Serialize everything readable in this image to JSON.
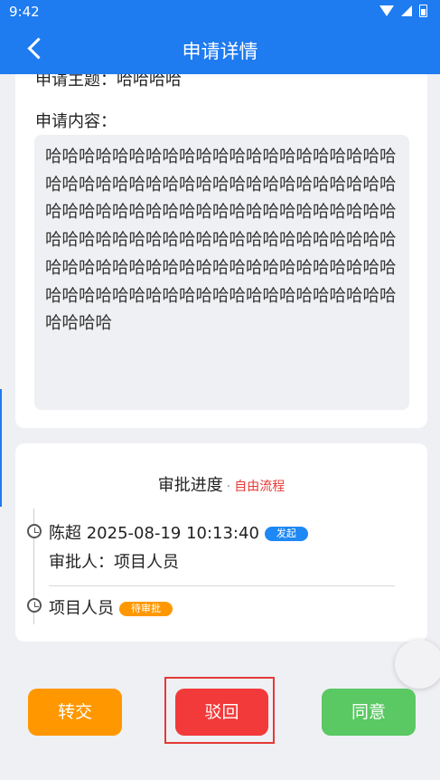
{
  "status_bar": {
    "time": "9:42"
  },
  "header": {
    "title": "申请详情"
  },
  "application": {
    "subject_label": "申请主题：",
    "subject_value": "哈哈哈哈",
    "content_label": "申请内容：",
    "content_text": "哈哈哈哈哈哈哈哈哈哈哈哈哈哈哈哈哈哈哈哈哈哈哈哈哈哈哈哈哈哈哈哈哈哈哈哈哈哈哈哈哈哈哈哈哈哈哈哈哈哈哈哈哈哈哈哈哈哈哈哈哈哈哈哈哈哈哈哈哈哈哈哈哈哈哈哈哈哈哈哈哈哈哈哈哈哈哈哈哈哈哈哈哈哈哈哈哈哈哈哈哈哈哈哈哈哈哈哈哈哈哈哈哈哈哈哈哈哈哈哈哈哈哈哈哈哈哈哈哈哈"
  },
  "progress": {
    "title": "审批进度",
    "separator": "·",
    "flow_type": "自由流程",
    "steps": [
      {
        "name": "陈超",
        "time": "2025-08-19 10:13:40",
        "badge": "发起",
        "approver_label": "审批人：",
        "approver": "项目人员"
      },
      {
        "name": "项目人员",
        "badge": "待审批"
      }
    ]
  },
  "actions": {
    "transfer": "转交",
    "reject": "驳回",
    "agree": "同意"
  },
  "colors": {
    "primary": "#1e7bf0",
    "transfer": "#ff9800",
    "reject": "#f23a3a",
    "agree": "#5ac863",
    "flow_type": "#e53935"
  }
}
